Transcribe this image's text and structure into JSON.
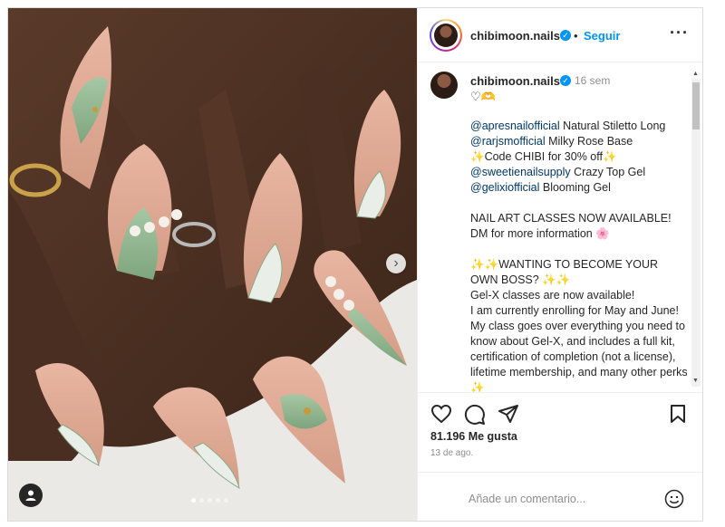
{
  "post": {
    "username": "chibimoon.nails",
    "follow_label": "Seguir",
    "separator": "•",
    "more_icon": "···",
    "time_ago": "16 sem",
    "hearts": "♡🫶",
    "caption": [
      {
        "mention": "@apresnailofficial",
        "text": " Natural Stiletto Long"
      },
      {
        "mention": "@rarjsmofficial",
        "text": " Milky Rose Base"
      },
      {
        "mention": "",
        "text": "✨Code CHIBI for 30% off✨"
      },
      {
        "mention": "@sweetienailsupply",
        "text": " Crazy Top Gel"
      },
      {
        "mention": "@gelixiofficial",
        "text": " Blooming Gel"
      },
      {
        "mention": "",
        "text": ""
      },
      {
        "mention": "",
        "text": "NAIL ART CLASSES NOW AVAILABLE! DM for more information 🌸"
      },
      {
        "mention": "",
        "text": ""
      },
      {
        "mention": "",
        "text": "✨✨WANTING TO BECOME YOUR OWN BOSS? ✨✨"
      },
      {
        "mention": "",
        "text": "Gel-X classes are now available!"
      },
      {
        "mention": "",
        "text": "I am currently enrolling for May and June! My class goes over everything you need to know about Gel-X, and includes a full kit, certification of completion (not a license), lifetime membership, and many other perks ✨"
      }
    ],
    "likes": "81.196 Me gusta",
    "date": "13 de ago.",
    "comment_placeholder": "Añade un comentario...",
    "carousel": {
      "count": 5,
      "active": 0
    }
  },
  "colors": {
    "accent": "#0095f6",
    "mention": "#00376b",
    "muted": "#8e8e8e"
  },
  "icons": [
    "verified-icon",
    "more-icon",
    "heart-icon",
    "comment-icon",
    "share-icon",
    "save-icon",
    "emoji-icon",
    "tag-user-icon",
    "chevron-right-icon"
  ]
}
